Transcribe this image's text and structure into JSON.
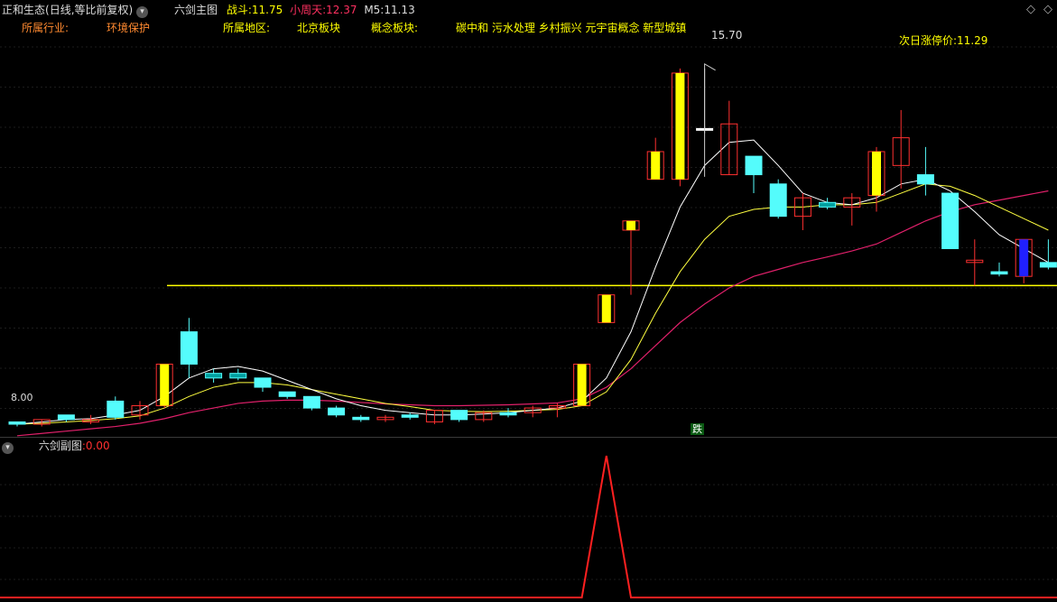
{
  "header": {
    "stock_name": "正和生态",
    "period": "(日线,等比前复权)",
    "main_chart_name": "六剑主图",
    "zhandou_label": "战斗:",
    "zhandou_value": "11.75",
    "xiaozhoutian_label": "小周天:",
    "xiaozhoutian_value": "12.37",
    "m5_label": "M5:",
    "m5_value": "11.13"
  },
  "info": {
    "industry_label": "所属行业:",
    "industry_value": "环境保护",
    "region_label": "所属地区:",
    "region_value": "北京板块",
    "concept_label": "概念板块:",
    "concept_value": "碳中和 污水处理 乡村振兴 元宇宙概念 新型城镇",
    "next_limit_label": "次日涨停价:",
    "next_limit_value": "11.29"
  },
  "annotations": {
    "high_price": "15.70",
    "low_price": "8.00",
    "signal": "跌"
  },
  "sub_chart": {
    "name": "六剑副图",
    "separator": ":",
    "value": "0.00"
  },
  "colors": {
    "background": "#000000",
    "up_candle": "#ff3030",
    "down_candle": "#54fcfc",
    "yellow_bar": "#ffff00",
    "blue_bar": "#2020ff",
    "white_line": "#ffffff",
    "yellow_line": "#ffff40",
    "magenta_line": "#e0206a",
    "hline": "#ffff00",
    "sub_line": "#ff2020"
  },
  "chart_data": {
    "type": "candlestick",
    "ylim": [
      8.0,
      16.4
    ],
    "hline": 11.0,
    "candles": [
      {
        "o": 8.0,
        "h": 8.05,
        "l": 7.95,
        "c": 8.05,
        "s": "down"
      },
      {
        "o": 8.0,
        "h": 8.1,
        "l": 7.95,
        "c": 8.1,
        "s": "up"
      },
      {
        "o": 8.1,
        "h": 8.2,
        "l": 8.05,
        "c": 8.2,
        "s": "down"
      },
      {
        "o": 8.05,
        "h": 8.2,
        "l": 8.0,
        "c": 8.1,
        "s": "up"
      },
      {
        "o": 8.15,
        "h": 8.6,
        "l": 8.1,
        "c": 8.5,
        "s": "down"
      },
      {
        "o": 8.2,
        "h": 8.5,
        "l": 8.1,
        "c": 8.4,
        "s": "up"
      },
      {
        "o": 8.4,
        "h": 9.3,
        "l": 8.35,
        "c": 9.3,
        "s": "yellow"
      },
      {
        "o": 10.0,
        "h": 10.3,
        "l": 9.0,
        "c": 9.3,
        "s": "down"
      },
      {
        "o": 9.1,
        "h": 9.2,
        "l": 8.9,
        "c": 9.0,
        "s": "teal"
      },
      {
        "o": 9.0,
        "h": 9.2,
        "l": 8.95,
        "c": 9.1,
        "s": "teal"
      },
      {
        "o": 9.0,
        "h": 9.0,
        "l": 8.7,
        "c": 8.8,
        "s": "down"
      },
      {
        "o": 8.7,
        "h": 8.7,
        "l": 8.55,
        "c": 8.6,
        "s": "down"
      },
      {
        "o": 8.6,
        "h": 8.6,
        "l": 8.3,
        "c": 8.35,
        "s": "down"
      },
      {
        "o": 8.35,
        "h": 8.4,
        "l": 8.15,
        "c": 8.2,
        "s": "down"
      },
      {
        "o": 8.15,
        "h": 8.2,
        "l": 8.05,
        "c": 8.1,
        "s": "down"
      },
      {
        "o": 8.1,
        "h": 8.2,
        "l": 8.05,
        "c": 8.15,
        "s": "up"
      },
      {
        "o": 8.2,
        "h": 8.25,
        "l": 8.1,
        "c": 8.15,
        "s": "down"
      },
      {
        "o": 8.05,
        "h": 8.3,
        "l": 8.0,
        "c": 8.3,
        "s": "up"
      },
      {
        "o": 8.3,
        "h": 8.3,
        "l": 8.05,
        "c": 8.1,
        "s": "down"
      },
      {
        "o": 8.1,
        "h": 8.3,
        "l": 8.05,
        "c": 8.25,
        "s": "up"
      },
      {
        "o": 8.25,
        "h": 8.35,
        "l": 8.15,
        "c": 8.2,
        "s": "down"
      },
      {
        "o": 8.25,
        "h": 8.4,
        "l": 8.15,
        "c": 8.35,
        "s": "up"
      },
      {
        "o": 8.35,
        "h": 8.45,
        "l": 8.15,
        "c": 8.4,
        "s": "up"
      },
      {
        "o": 8.4,
        "h": 9.3,
        "l": 8.4,
        "c": 9.3,
        "s": "yellow"
      },
      {
        "o": 10.2,
        "h": 10.8,
        "l": 10.2,
        "c": 10.8,
        "s": "yellow"
      },
      {
        "o": 12.2,
        "h": 12.25,
        "l": 10.8,
        "c": 12.4,
        "s": "yellow"
      },
      {
        "o": 13.3,
        "h": 14.2,
        "l": 13.4,
        "c": 13.9,
        "s": "yellow"
      },
      {
        "o": 13.3,
        "h": 15.7,
        "l": 13.15,
        "c": 15.6,
        "s": "yellow"
      },
      {
        "o": 14.4,
        "h": 15.7,
        "l": 14.3,
        "c": 14.4,
        "s": "doji"
      },
      {
        "o": 13.4,
        "h": 15.0,
        "l": 13.4,
        "c": 14.5,
        "s": "up"
      },
      {
        "o": 13.8,
        "h": 13.8,
        "l": 13.0,
        "c": 13.4,
        "s": "down"
      },
      {
        "o": 13.2,
        "h": 13.3,
        "l": 12.45,
        "c": 12.5,
        "s": "down"
      },
      {
        "o": 12.5,
        "h": 13.0,
        "l": 12.2,
        "c": 12.9,
        "s": "up"
      },
      {
        "o": 12.8,
        "h": 12.9,
        "l": 12.65,
        "c": 12.7,
        "s": "teal"
      },
      {
        "o": 12.7,
        "h": 13.0,
        "l": 12.3,
        "c": 12.9,
        "s": "up"
      },
      {
        "o": 12.95,
        "h": 14.0,
        "l": 12.6,
        "c": 13.9,
        "s": "yellow"
      },
      {
        "o": 13.6,
        "h": 14.8,
        "l": 13.1,
        "c": 14.2,
        "s": "up"
      },
      {
        "o": 13.2,
        "h": 14.0,
        "l": 12.95,
        "c": 13.4,
        "s": "down"
      },
      {
        "o": 13.0,
        "h": 13.0,
        "l": 11.8,
        "c": 11.8,
        "s": "down"
      },
      {
        "o": 11.5,
        "h": 12.0,
        "l": 11.0,
        "c": 11.55,
        "s": "up"
      },
      {
        "o": 11.3,
        "h": 11.5,
        "l": 11.2,
        "c": 11.25,
        "s": "down"
      },
      {
        "o": 11.2,
        "h": 11.7,
        "l": 11.05,
        "c": 12.0,
        "s": "blue"
      },
      {
        "o": 11.5,
        "h": 12.0,
        "l": 11.35,
        "c": 11.4,
        "s": "down"
      }
    ],
    "ma_white": [
      8.0,
      8.05,
      8.1,
      8.12,
      8.2,
      8.3,
      8.6,
      9.0,
      9.2,
      9.25,
      9.15,
      8.95,
      8.75,
      8.55,
      8.4,
      8.3,
      8.25,
      8.2,
      8.2,
      8.22,
      8.25,
      8.3,
      8.35,
      8.5,
      9.0,
      10.0,
      11.4,
      12.7,
      13.6,
      14.1,
      14.15,
      13.6,
      13.0,
      12.8,
      12.75,
      12.9,
      13.2,
      13.3,
      13.05,
      12.6,
      12.1,
      11.8,
      11.5
    ],
    "ma_yellow": [
      8.0,
      8.02,
      8.05,
      8.08,
      8.12,
      8.18,
      8.35,
      8.6,
      8.8,
      8.9,
      8.9,
      8.85,
      8.75,
      8.65,
      8.55,
      8.45,
      8.38,
      8.3,
      8.28,
      8.27,
      8.28,
      8.3,
      8.32,
      8.4,
      8.7,
      9.4,
      10.4,
      11.3,
      12.0,
      12.5,
      12.65,
      12.7,
      12.7,
      12.75,
      12.75,
      12.8,
      13.0,
      13.2,
      13.15,
      12.95,
      12.7,
      12.45,
      12.2
    ],
    "ma_magenta": [
      7.75,
      7.8,
      7.85,
      7.9,
      7.95,
      8.02,
      8.12,
      8.25,
      8.35,
      8.45,
      8.5,
      8.52,
      8.52,
      8.5,
      8.47,
      8.44,
      8.42,
      8.4,
      8.4,
      8.41,
      8.42,
      8.44,
      8.46,
      8.55,
      8.8,
      9.2,
      9.7,
      10.2,
      10.6,
      10.95,
      11.2,
      11.35,
      11.5,
      11.62,
      11.75,
      11.9,
      12.15,
      12.4,
      12.6,
      12.75,
      12.85,
      12.95,
      13.05
    ],
    "sub_values": [
      0,
      0,
      0,
      0,
      0,
      0,
      0,
      0,
      0,
      0,
      0,
      0,
      0,
      0,
      0,
      0,
      0,
      0,
      0,
      0,
      0,
      0,
      0,
      0,
      1,
      0,
      0,
      0,
      0,
      0,
      0,
      0,
      0,
      0,
      0,
      0,
      0,
      0,
      0,
      0,
      0,
      0,
      0
    ],
    "sub_value": "0.00"
  }
}
